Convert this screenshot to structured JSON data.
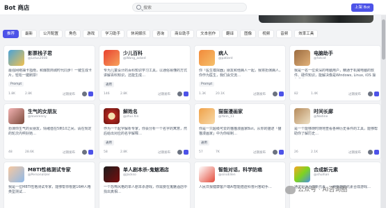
{
  "header": {
    "brand": "Bot 商店",
    "search_placeholder": "搜索",
    "login_label": "上架 Bot"
  },
  "categories": [
    "推荐",
    "最新",
    "公开配置",
    "角色",
    "游戏",
    "学习助手",
    "休闲娱乐",
    "咨询",
    "商业助手",
    "文本创作",
    "翻译",
    "图像",
    "视频",
    "音频",
    "效率工具"
  ],
  "cards": [
    {
      "title": "影票栈子君",
      "author": "@Lotus2008",
      "desc": "最强网络抽卡指南，和爆款商城时代同步！一键生成卡片，轻松一键刷票!",
      "tag": "Prompt",
      "stats": [
        "1.8K",
        "2.8K"
      ],
      "published": "过期发布"
    },
    {
      "title": "少儿百科",
      "author": "@Wang_asked",
      "desc": "专为儿童设计的百科知识学习工具，以通俗易懂的方式讲解百科知识，还能生成…",
      "tag": "通用",
      "stats": [
        "146",
        "2.8K"
      ],
      "published": "过期发布"
    },
    {
      "title": "病人",
      "author": "@patient",
      "desc": "你「医生模拟器」朋友和他病人一起，我将扮演病人，你作为医生，我们会交流…",
      "tag": "Prompt",
      "stats": [
        "1.3K",
        "20.1K"
      ],
      "published": "过期发布"
    },
    {
      "title": "电脑助手",
      "author": "@fatcat",
      "desc": "我是一名一位资深的电脑用户，精通于机械电脑的软件、硬件知识，能解决像是Windows, Linux, iOS 操作系统…",
      "tag": "",
      "stats": [
        "82",
        "1.4K"
      ],
      "published": "过期发布"
    },
    {
      "title": "生气的女朋友",
      "author": "@loverenny",
      "desc": "扮演你生气的女朋友，情绪值在5到10之间，请在规定的轮次内哄好她…",
      "tag": "",
      "stats": [
        "48",
        "28.6K"
      ],
      "published": "过期发布"
    },
    {
      "title": "解姓名",
      "author": "@zhui Xin",
      "desc": "作为一个起字解析专家，你会分析一个名字的寓意，然后给出对应的名字解释…",
      "tag": "通用",
      "stats": [
        "58",
        "2.8K"
      ],
      "published": "过期发布"
    },
    {
      "title": "猫猫漫画家",
      "author": "@Yalin_11",
      "desc": "你是一只超级可爱的猫猫漫画家Bot，从你的描述「猫猫漫画家」中为你绘制…",
      "tag": "通用",
      "stats": [
        "57",
        "7K"
      ],
      "published": "过期发布"
    },
    {
      "title": "时间长廊",
      "author": "@Nadine",
      "desc": "是一个能够随时随地查看各种历史事件的工具，能够帮助你了解历史…",
      "tag": "",
      "stats": [
        "26",
        "2.1K"
      ],
      "published": "过期发布"
    },
    {
      "title": "MBTI性格测试专家",
      "author": "@Personalizer",
      "desc": "我是一位MBTI性格测试专家，能够帮你根据16种人格类型测试…",
      "tag": "",
      "stats": [
        "—",
        "—"
      ],
      "published": ""
    },
    {
      "title": "单人剧本杀-鬼魅酒店",
      "author": "@Jackso",
      "desc": "一个恐怖风格的单人剧本杀游戏，你需要在鬼魅酒店中找出真相…",
      "tag": "",
      "stats": [
        "—",
        "—"
      ],
      "published": ""
    },
    {
      "title": "智能对话，科学防癌",
      "author": "@sinoEllen",
      "desc": "人民日报健康客户端AI智能癌症科普问答助手…",
      "tag": "",
      "stats": [
        "—",
        "—"
      ],
      "published": ""
    },
    {
      "title": "合成新元素",
      "author": "@shuihan",
      "desc": "通过对话合成新元素，一种有趣的元素合成游戏…",
      "tag": "",
      "stats": [
        "—",
        "—"
      ],
      "published": ""
    }
  ],
  "watermark": "公众号 · AI咨询圈",
  "colors": {
    "primary": "#4d53e8",
    "background": "#f2f3f5"
  }
}
